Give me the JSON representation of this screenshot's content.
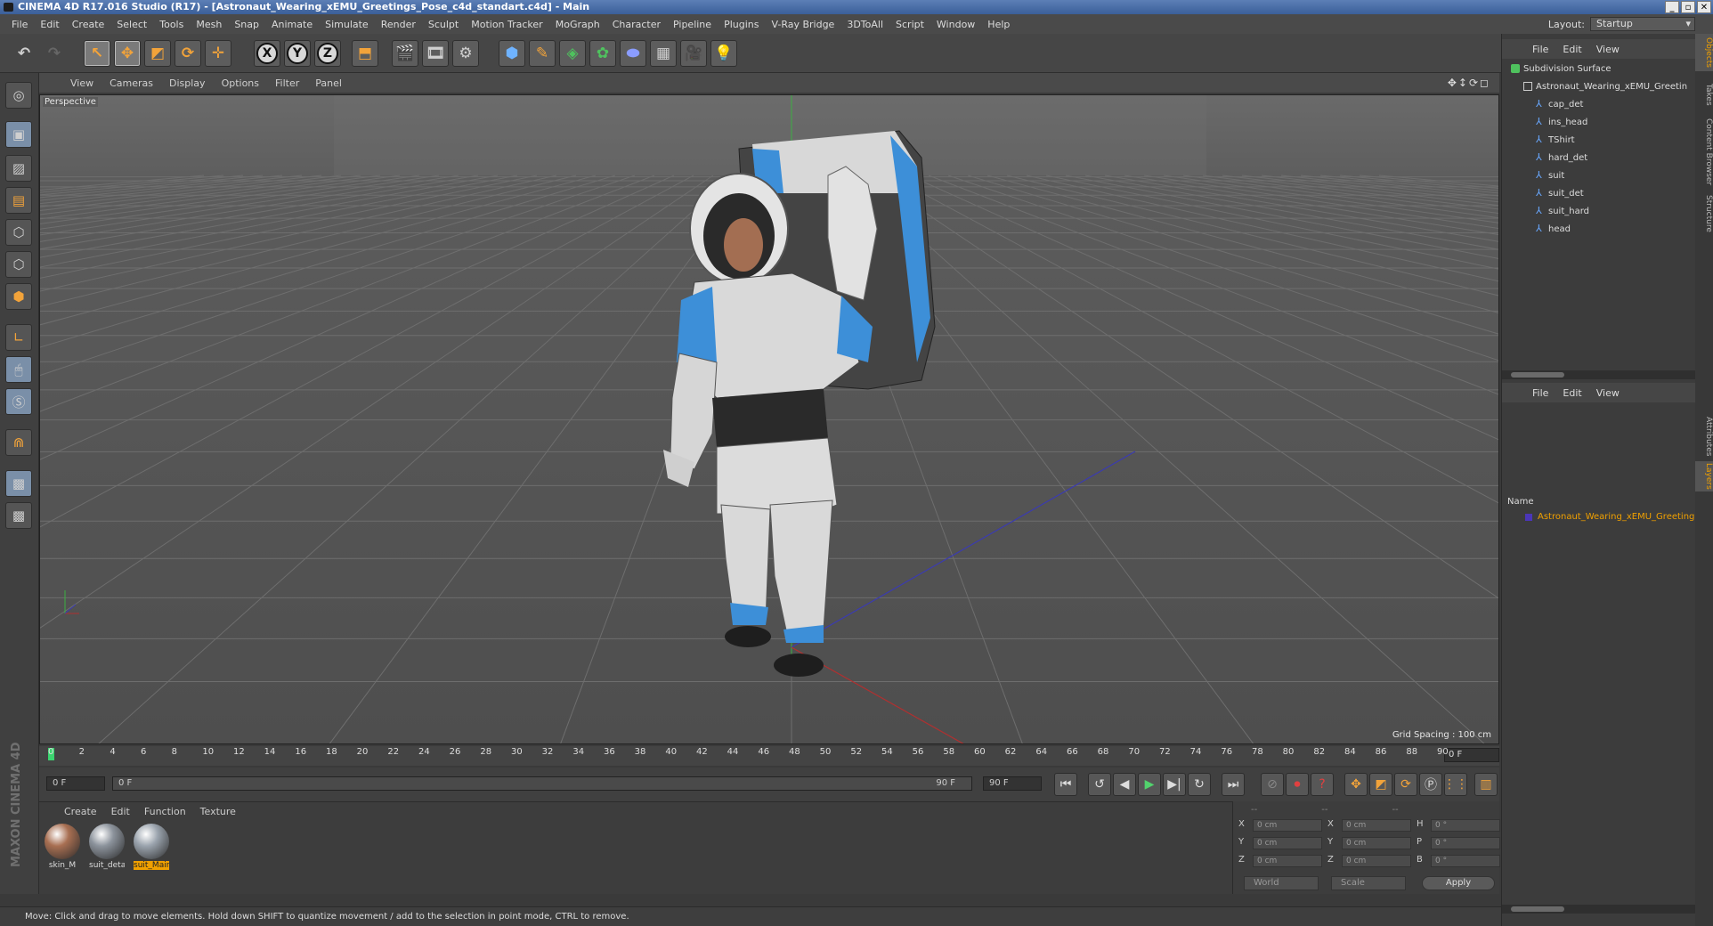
{
  "window": {
    "title": "CINEMA 4D R17.016 Studio (R17) - [Astronaut_Wearing_xEMU_Greetings_Pose_c4d_standart.c4d] - Main",
    "controls": [
      "_",
      "▫",
      "✕"
    ]
  },
  "menu": [
    "File",
    "Edit",
    "Create",
    "Select",
    "Tools",
    "Mesh",
    "Snap",
    "Animate",
    "Simulate",
    "Render",
    "Sculpt",
    "Motion Tracker",
    "MoGraph",
    "Character",
    "Pipeline",
    "Plugins",
    "V-Ray Bridge",
    "3DToAll",
    "Script",
    "Window",
    "Help"
  ],
  "layout": {
    "label": "Layout:",
    "value": "Startup"
  },
  "toolbar": {
    "x": "X",
    "y": "Y",
    "z": "Z"
  },
  "viewport": {
    "menu": [
      "View",
      "Cameras",
      "Display",
      "Options",
      "Filter",
      "Panel"
    ],
    "label": "Perspective",
    "grid_spacing": "Grid Spacing : 100 cm",
    "nav_icons": "✥↕⟳◻"
  },
  "timeline": {
    "ticks": [
      "0",
      "2",
      "4",
      "6",
      "8",
      "10",
      "12",
      "14",
      "16",
      "18",
      "20",
      "22",
      "24",
      "26",
      "28",
      "30",
      "32",
      "34",
      "36",
      "38",
      "40",
      "42",
      "44",
      "46",
      "48",
      "50",
      "52",
      "54",
      "56",
      "58",
      "60",
      "62",
      "64",
      "66",
      "68",
      "70",
      "72",
      "74",
      "76",
      "78",
      "80",
      "82",
      "84",
      "86",
      "88",
      "90"
    ],
    "current_frame": "0 F"
  },
  "playbar": {
    "start": "0 F",
    "range_start": "0 F",
    "range_end": "90 F",
    "end": "90 F"
  },
  "materials": {
    "menu": [
      "Create",
      "Edit",
      "Function",
      "Texture"
    ],
    "items": [
      {
        "name": "skin_M",
        "selected": false,
        "color": "#a86f52"
      },
      {
        "name": "suit_deta",
        "selected": false,
        "color": "#8c939c"
      },
      {
        "name": "suit_Main",
        "selected": true,
        "color": "#9aa3ad"
      }
    ]
  },
  "coords": {
    "header": [
      "--",
      "--",
      "--"
    ],
    "rows": [
      {
        "a": "X",
        "av": "0 cm",
        "b": "X",
        "bv": "0 cm",
        "c": "H",
        "cv": "0 °"
      },
      {
        "a": "Y",
        "av": "0 cm",
        "b": "Y",
        "bv": "0 cm",
        "c": "P",
        "cv": "0 °"
      },
      {
        "a": "Z",
        "av": "0 cm",
        "b": "Z",
        "bv": "0 cm",
        "c": "B",
        "cv": "0 °"
      }
    ],
    "world": "World",
    "scale": "Scale",
    "apply": "Apply"
  },
  "status": "Move: Click and drag to move elements. Hold down SHIFT to quantize movement / add to the selection in point mode, CTRL to remove.",
  "objects": {
    "menu": [
      "File",
      "Edit",
      "View"
    ],
    "items": [
      {
        "name": "Subdivision Surface",
        "kind": "root",
        "indent": 0
      },
      {
        "name": "Astronaut_Wearing_xEMU_Greetin",
        "kind": "grp",
        "indent": 1
      },
      {
        "name": "cap_det",
        "kind": "bone",
        "indent": 2
      },
      {
        "name": "ins_head",
        "kind": "bone",
        "indent": 2
      },
      {
        "name": "TShirt",
        "kind": "bone",
        "indent": 2
      },
      {
        "name": "hard_det",
        "kind": "bone",
        "indent": 2
      },
      {
        "name": "suit",
        "kind": "bone",
        "indent": 2
      },
      {
        "name": "suit_det",
        "kind": "bone",
        "indent": 2
      },
      {
        "name": "suit_hard",
        "kind": "bone",
        "indent": 2
      },
      {
        "name": "head",
        "kind": "bone",
        "indent": 2
      }
    ]
  },
  "layers": {
    "menu": [
      "File",
      "Edit",
      "View"
    ],
    "header": "Name",
    "row": "Astronaut_Wearing_xEMU_Greeting"
  },
  "side_tabs": [
    "Objects",
    "Takes",
    "Content Browser",
    "Structure",
    "Attributes",
    "Layers"
  ],
  "branding": "MAXON CINEMA 4D",
  "colors": {
    "accent": "#f0a000",
    "bone": "#69a8ff"
  }
}
